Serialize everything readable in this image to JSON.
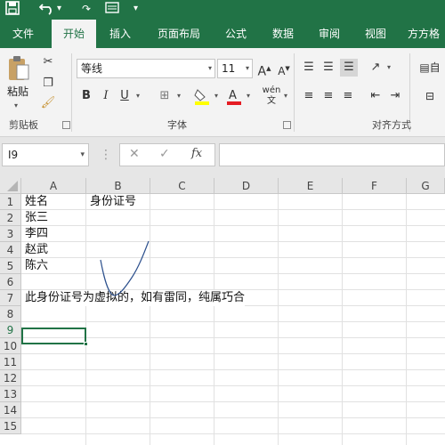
{
  "quick_access": {
    "save_icon": "save-icon",
    "undo_icon": "undo-icon",
    "customize_icon": "customize-icon"
  },
  "tabs": [
    {
      "label": "文件"
    },
    {
      "label": "开始"
    },
    {
      "label": "插入"
    },
    {
      "label": "页面布局"
    },
    {
      "label": "公式"
    },
    {
      "label": "数据"
    },
    {
      "label": "审阅"
    },
    {
      "label": "视图"
    },
    {
      "label": "方方格"
    }
  ],
  "ribbon": {
    "clipboard": {
      "paste_label": "粘贴",
      "group_label": "剪贴板"
    },
    "font": {
      "font_name": "等线",
      "font_size": "11",
      "bold": "B",
      "italic": "I",
      "underline": "U",
      "increase": "A",
      "decrease": "A",
      "group_label": "字体"
    },
    "alignment": {
      "group_label": "对齐方式",
      "auto_label": "自"
    }
  },
  "formula_bar": {
    "name_box": "I9",
    "fx": "fx",
    "formula": ""
  },
  "columns": [
    "A",
    "B",
    "C",
    "D",
    "E",
    "F",
    "G"
  ],
  "rows": [
    "1",
    "2",
    "3",
    "4",
    "5",
    "6",
    "7",
    "8",
    "9",
    "10",
    "11",
    "12",
    "13",
    "14",
    "15"
  ],
  "cells": {
    "A1": "姓名",
    "B1": "身份证号",
    "A2": "张三",
    "A3": "李四",
    "A4": "赵武",
    "A5": "陈六",
    "A7": "此身份证号为虚拟的，如有雷同，纯属巧合"
  },
  "selected_cell": "I9",
  "colors": {
    "accent": "#217346",
    "ink": "#2b4f8c"
  }
}
